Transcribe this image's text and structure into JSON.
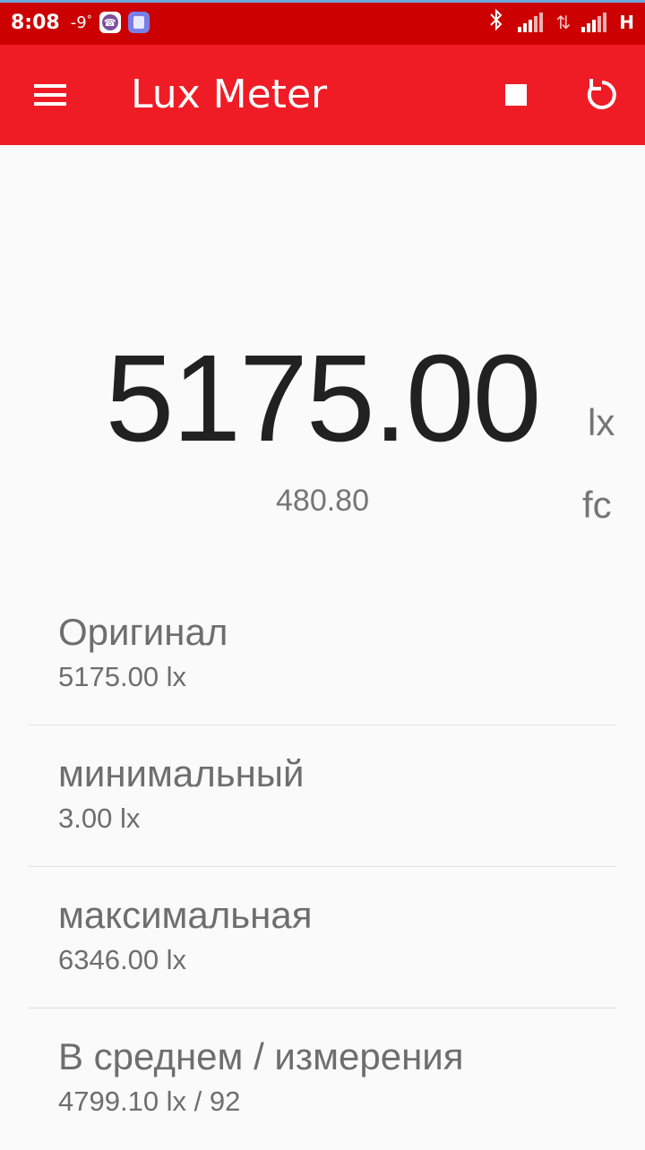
{
  "status_bar": {
    "time": "8:08",
    "temperature": "-9",
    "temperature_unit": "°",
    "network_type": "H",
    "colors": {
      "background": "#cc0000"
    }
  },
  "app_bar": {
    "title": "Lux Meter",
    "color": "#ef1c26",
    "icons": [
      "menu-icon",
      "stop-icon",
      "refresh-icon"
    ]
  },
  "reading": {
    "lux_value": "5175.00",
    "lux_unit": "lx",
    "fc_value": "480.80",
    "fc_unit": "fc"
  },
  "stats": [
    {
      "label": "Оригинал",
      "value": "5175.00 lx"
    },
    {
      "label": "минимальный",
      "value": "3.00 lx"
    },
    {
      "label": "максимальная",
      "value": "6346.00 lx"
    },
    {
      "label": "В среднем / измерения",
      "value": "4799.10 lx / 92"
    }
  ]
}
